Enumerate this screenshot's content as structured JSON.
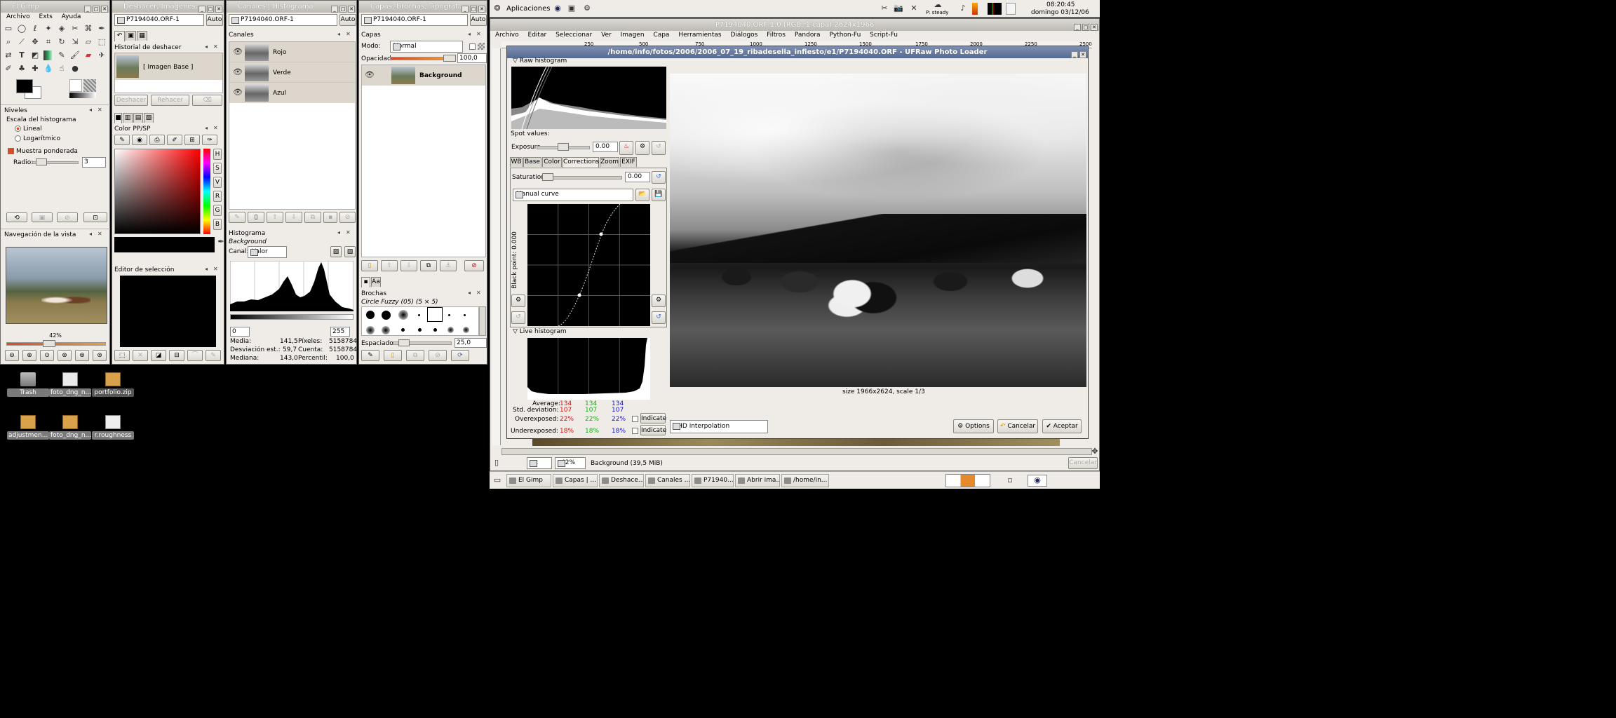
{
  "gimp_toolbox": {
    "title": "El Gimp",
    "menu": [
      "Archivo",
      "Exts",
      "Ayuda"
    ],
    "levels_title": "Niveles",
    "histogram_scale": "Escala del histograma",
    "linear": "Lineal",
    "logarithmic": "Logarítmico",
    "weighted": "Muestra ponderada",
    "radius_label": "Radio:",
    "radius_value": "3",
    "nav_title": "Navegación de la vista",
    "zoom_pct": "42%"
  },
  "undo_window": {
    "title": "Deshacer, Imágenes, ...",
    "image": "P7194040.ORF-1",
    "auto": "Auto",
    "history_title": "Historial de deshacer",
    "history_item": "[ Imagen Base ]",
    "undo_btn": "Deshacer",
    "redo_btn": "Rehacer",
    "fgbg_title": "Color PP/SP",
    "selection_editor": "Editor de selección"
  },
  "channels_window": {
    "title": "Canales | Histograma",
    "image": "P7194040.ORF-1",
    "auto": "Auto",
    "channels_title": "Canales",
    "channels": [
      "Rojo",
      "Verde",
      "Azul"
    ],
    "histogram_title": "Histograma",
    "histogram_layer": "Background",
    "channel_label": "Canal:",
    "channel_value": "Valor",
    "range_min": "0",
    "range_max": "255",
    "stats": {
      "mean_label": "Media:",
      "mean": "141,5",
      "pixels_label": "Píxeles:",
      "pixels": "5158784",
      "std_label": "Desviación est.:",
      "std": "59,7",
      "count_label": "Cuenta:",
      "count": "5158784",
      "median_label": "Mediana:",
      "median": "143,0",
      "percentile_label": "Percentil:",
      "percentile": "100,0"
    }
  },
  "layers_window": {
    "title": "Capas, Brochas, Tipograf...",
    "image": "P7194040.ORF-1",
    "auto": "Auto",
    "layers_title": "Capas",
    "mode_label": "Modo:",
    "mode_value": "Normal",
    "opacity_label": "Opacidad:",
    "opacity_value": "100,0",
    "layer_name": "Background",
    "brushes_title": "Brochas",
    "brush_name": "Circle Fuzzy (05) (5 × 5)",
    "spacing_label": "Espaciado:",
    "spacing_value": "25,0"
  },
  "desktop_icons": [
    "Trash",
    "foto_dng_n...",
    "portfolio.zip",
    "adjustmen...",
    "foto_dng_n...",
    "r.roughness"
  ],
  "top_panel": {
    "apps": "Aplicaciones",
    "weather": "P: steady",
    "time": "08:20:45",
    "date": "domingo 03/12/06"
  },
  "image_window": {
    "title": "P7194040.ORF-1.0 (RGB, 1 capa) 2624x1966",
    "menu": [
      "Archivo",
      "Editar",
      "Seleccionar",
      "Ver",
      "Imagen",
      "Capa",
      "Herramientas",
      "Diálogos",
      "Filtros",
      "Pandora",
      "Python-Fu",
      "Script-Fu"
    ],
    "ruler": [
      "250",
      "500",
      "750",
      "1000",
      "1250",
      "1500",
      "1750",
      "2000",
      "2250",
      "2500"
    ],
    "unit": "px",
    "zoom": "42%",
    "status": "Background (39,5 MiB)",
    "cancel": "Cancelar"
  },
  "ufraw": {
    "title": "/home/info/fotos/2006/2006_07_19_ribadesella_infiesto/e1/P7194040.ORF - UFRaw Photo Loader",
    "raw_histogram": "Raw histogram",
    "spot_values": "Spot values:",
    "exposure_label": "Exposure",
    "exposure_value": "0.00",
    "tabs": [
      "WB",
      "Base",
      "Color",
      "Corrections",
      "Zoom",
      "EXIF"
    ],
    "active_tab": "Corrections",
    "saturation_label": "Saturation",
    "saturation_value": "0.00",
    "curve_select": "Manual curve",
    "black_point": "Black point: 0.000",
    "live_histogram": "Live histogram",
    "average_label": "Average:",
    "average": [
      "134",
      "134",
      "134"
    ],
    "std_label": "Std. deviation:",
    "std": [
      "107",
      "107",
      "107"
    ],
    "over_label": "Overexposed:",
    "over": [
      "22%",
      "22%",
      "22%"
    ],
    "under_label": "Underexposed:",
    "under": [
      "18%",
      "18%",
      "18%"
    ],
    "indicate": "Indicate",
    "size_label": "size 1966x2624, scale 1/3",
    "interpolation": "AHD interpolation",
    "options": "Options",
    "cancel": "Cancelar",
    "accept": "Aceptar",
    "colors": {
      "r": "#d01010",
      "g": "#10b010",
      "b": "#1010d0"
    }
  },
  "taskbar": [
    "El Gimp",
    "Capas | ...",
    "Deshace...",
    "Canales ...",
    "P71940...",
    "Abrir ima...",
    "/home/in..."
  ]
}
